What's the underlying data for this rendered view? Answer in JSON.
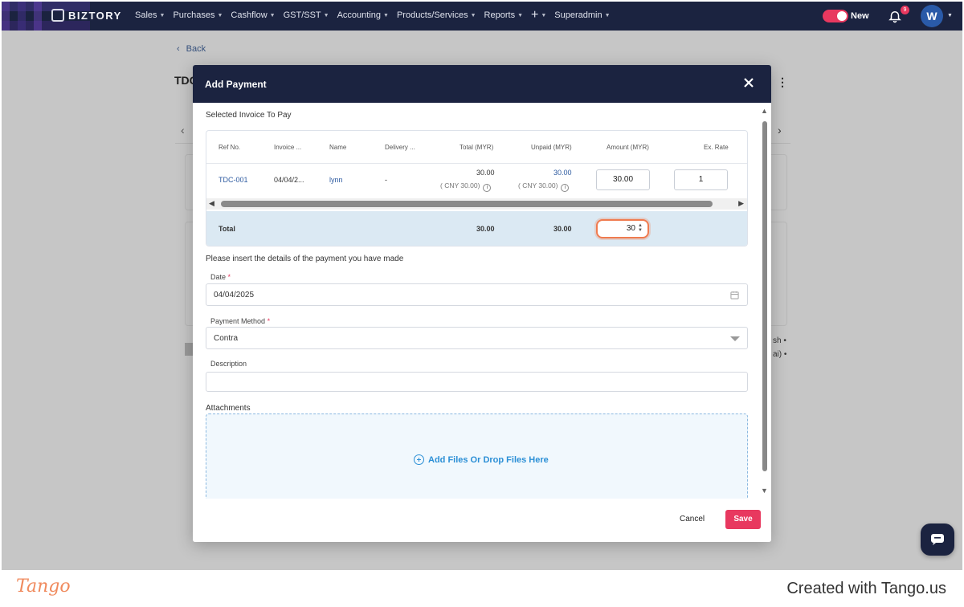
{
  "app": {
    "brand": "BIZTORY",
    "nav": [
      "Sales",
      "Purchases",
      "Cashflow",
      "GST/SST",
      "Accounting",
      "Products/Services",
      "Reports",
      "+",
      "Superadmin"
    ],
    "toggle_label": "New",
    "notification_count": "9",
    "avatar_initial": "W",
    "accent_color": "#e8385f",
    "nav_bg": "#1b2340"
  },
  "background": {
    "back_label": "Back",
    "title_fragment": "TDC",
    "side_text_1": "sh •",
    "side_text_2": "ai) •"
  },
  "modal": {
    "title": "Add Payment",
    "selected_label": "Selected Invoice To Pay",
    "table": {
      "headers": [
        "Ref No.",
        "Invoice ...",
        "Name",
        "Delivery ...",
        "Total (MYR)",
        "Unpaid (MYR)",
        "Amount (MYR)",
        "Ex. Rate"
      ],
      "row": {
        "ref": "TDC-001",
        "invoice": "04/04/2...",
        "name": "lynn",
        "delivery": "-",
        "total": "30.00",
        "total_sub": "( CNY 30.00)",
        "unpaid": "30.00",
        "unpaid_sub": "( CNY 30.00)",
        "amount": "30.00",
        "ex_rate": "1"
      },
      "total_row": {
        "label": "Total",
        "total": "30.00",
        "unpaid": "30.00",
        "amount_input": "30"
      }
    },
    "details_label": "Please insert the details of the payment you have made",
    "date_label": "Date",
    "date_value": "04/04/2025",
    "method_label": "Payment Method",
    "method_value": "Contra",
    "description_label": "Description",
    "description_value": "",
    "attachments_label": "Attachments",
    "dropzone_text": "Add Files  Or Drop Files Here",
    "cancel_label": "Cancel",
    "save_label": "Save"
  },
  "footer": {
    "tango_logo": "Tango",
    "created_with": "Created with Tango.us"
  }
}
